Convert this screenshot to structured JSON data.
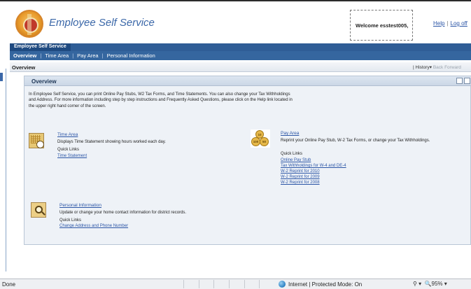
{
  "header": {
    "app_title": "Employee Self Service",
    "welcome": "Welcome esstest005,",
    "help_link": "Help",
    "logoff_link": "Log off"
  },
  "nav": {
    "level1": "Employee Self Service",
    "tabs": [
      {
        "label": "Overview"
      },
      {
        "label": "Time Area"
      },
      {
        "label": "Pay Area"
      },
      {
        "label": "Personal Information"
      }
    ]
  },
  "breadcrumb": {
    "current": "Overview",
    "history": "History",
    "back": "Back",
    "forward": "Forward"
  },
  "overview": {
    "title": "Overview",
    "intro": "In Employee Self Service, you can print Online Pay Stubs, W2 Tax Forms, and Time Statements. You can also change your Tax Withholdings and Address.  For more information including step by step instructions and Frequently Asked Questions, please click on the Help link located in the upper right hand corner of the screen.",
    "sections": {
      "time": {
        "title": "Time Area",
        "desc": "Displays Time Statement showing hours worked each day.",
        "quick_links_label": "Quick Links",
        "links": [
          "Time Statement"
        ]
      },
      "pay": {
        "title": "Pay Area",
        "desc": "Reprint your Online Pay Stub, W-2 Tax Forms, or change your Tax Withholdings.",
        "quick_links_label": "Quick Links",
        "links": [
          "Online Pay Stub",
          "Tax Withholdings for W-4 and DE-4",
          "W-2 Reprint for 2010",
          "W-2 Reprint for 2009",
          "W-2 Reprint for 2008"
        ],
        "coin_labels": [
          "100",
          "50",
          "10"
        ]
      },
      "personal": {
        "title": "Personal Information",
        "desc": "Update or change your home contact information for district records.",
        "quick_links_label": "Quick Links",
        "links": [
          "Change Address and Phone Number"
        ]
      }
    }
  },
  "statusbar": {
    "done": "Done",
    "zone": "Internet | Protected Mode: On",
    "zoom": "95%"
  }
}
